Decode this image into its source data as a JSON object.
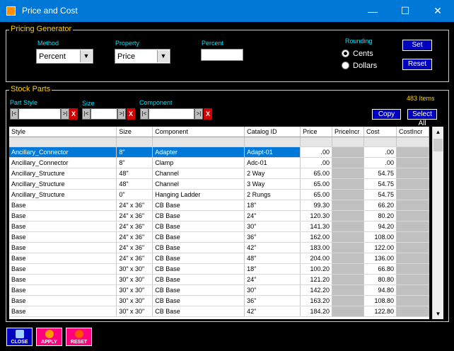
{
  "window": {
    "title": "Price and Cost",
    "min_glyph": "—",
    "max_glyph": "☐",
    "close_glyph": "✕"
  },
  "pricing": {
    "legend": "Pricing Generator",
    "method_label": "Method",
    "method_value": "Percent",
    "property_label": "Property",
    "property_value": "Price",
    "percent_label": "Percent",
    "percent_value": "",
    "rounding_label": "Rounding",
    "rounding_options": [
      "Cents",
      "Dollars"
    ],
    "rounding_selected": "Cents",
    "set_label": "Set",
    "reset_label": "Reset"
  },
  "stock": {
    "legend": "Stock Parts",
    "item_count": "483 Items",
    "filters": {
      "part_style": "Part Style",
      "size": "Size",
      "component": "Component"
    },
    "copy_label": "Copy",
    "select_all_label": "Select All",
    "columns": [
      "Style",
      "Size",
      "Component",
      "Catalog ID",
      "Price",
      "PriceIncr",
      "Cost",
      "CostIncr"
    ],
    "rows": [
      [
        "Ancillary_Connector",
        "8\"",
        "Adapter",
        "Adapt-01",
        ".00",
        "",
        ".00",
        ""
      ],
      [
        "Ancillary_Connector",
        "8\"",
        "Clamp",
        "Adc-01",
        ".00",
        "",
        ".00",
        ""
      ],
      [
        "Ancillary_Structure",
        "48\"",
        "Channel",
        "2 Way",
        "65.00",
        "",
        "54.75",
        ""
      ],
      [
        "Ancillary_Structure",
        "48\"",
        "Channel",
        "3 Way",
        "65.00",
        "",
        "54.75",
        ""
      ],
      [
        "Ancillary_Structure",
        "0\"",
        "Hanging Ladder",
        "2 Rungs",
        "65.00",
        "",
        "54.75",
        ""
      ],
      [
        "Base",
        "24\" x 36\"",
        "CB Base",
        "18\"",
        "99.30",
        "",
        "66.20",
        ""
      ],
      [
        "Base",
        "24\" x 36\"",
        "CB Base",
        "24\"",
        "120.30",
        "",
        "80.20",
        ""
      ],
      [
        "Base",
        "24\" x 36\"",
        "CB Base",
        "30\"",
        "141.30",
        "",
        "94.20",
        ""
      ],
      [
        "Base",
        "24\" x 36\"",
        "CB Base",
        "36\"",
        "162.00",
        "",
        "108.00",
        ""
      ],
      [
        "Base",
        "24\" x 36\"",
        "CB Base",
        "42\"",
        "183.00",
        "",
        "122.00",
        ""
      ],
      [
        "Base",
        "24\" x 36\"",
        "CB Base",
        "48\"",
        "204.00",
        "",
        "136.00",
        ""
      ],
      [
        "Base",
        "30\" x 30\"",
        "CB Base",
        "18\"",
        "100.20",
        "",
        "66.80",
        ""
      ],
      [
        "Base",
        "30\" x 30\"",
        "CB Base",
        "24\"",
        "121.20",
        "",
        "80.80",
        ""
      ],
      [
        "Base",
        "30\" x 30\"",
        "CB Base",
        "30\"",
        "142.20",
        "",
        "94.80",
        ""
      ],
      [
        "Base",
        "30\" x 30\"",
        "CB Base",
        "36\"",
        "163.20",
        "",
        "108.80",
        ""
      ],
      [
        "Base",
        "30\" x 30\"",
        "CB Base",
        "42\"",
        "184.20",
        "",
        "122.80",
        ""
      ]
    ],
    "selected_row": 0
  },
  "bottom": {
    "close_label": "CLOSE",
    "apply_label": "APPLY",
    "reset_label": "RESET"
  },
  "colors": {
    "title_bar": "#0078d7",
    "legend": "#ffd000",
    "label": "#00e5ff",
    "button": "#0000c0",
    "selection": "#0078d7"
  }
}
